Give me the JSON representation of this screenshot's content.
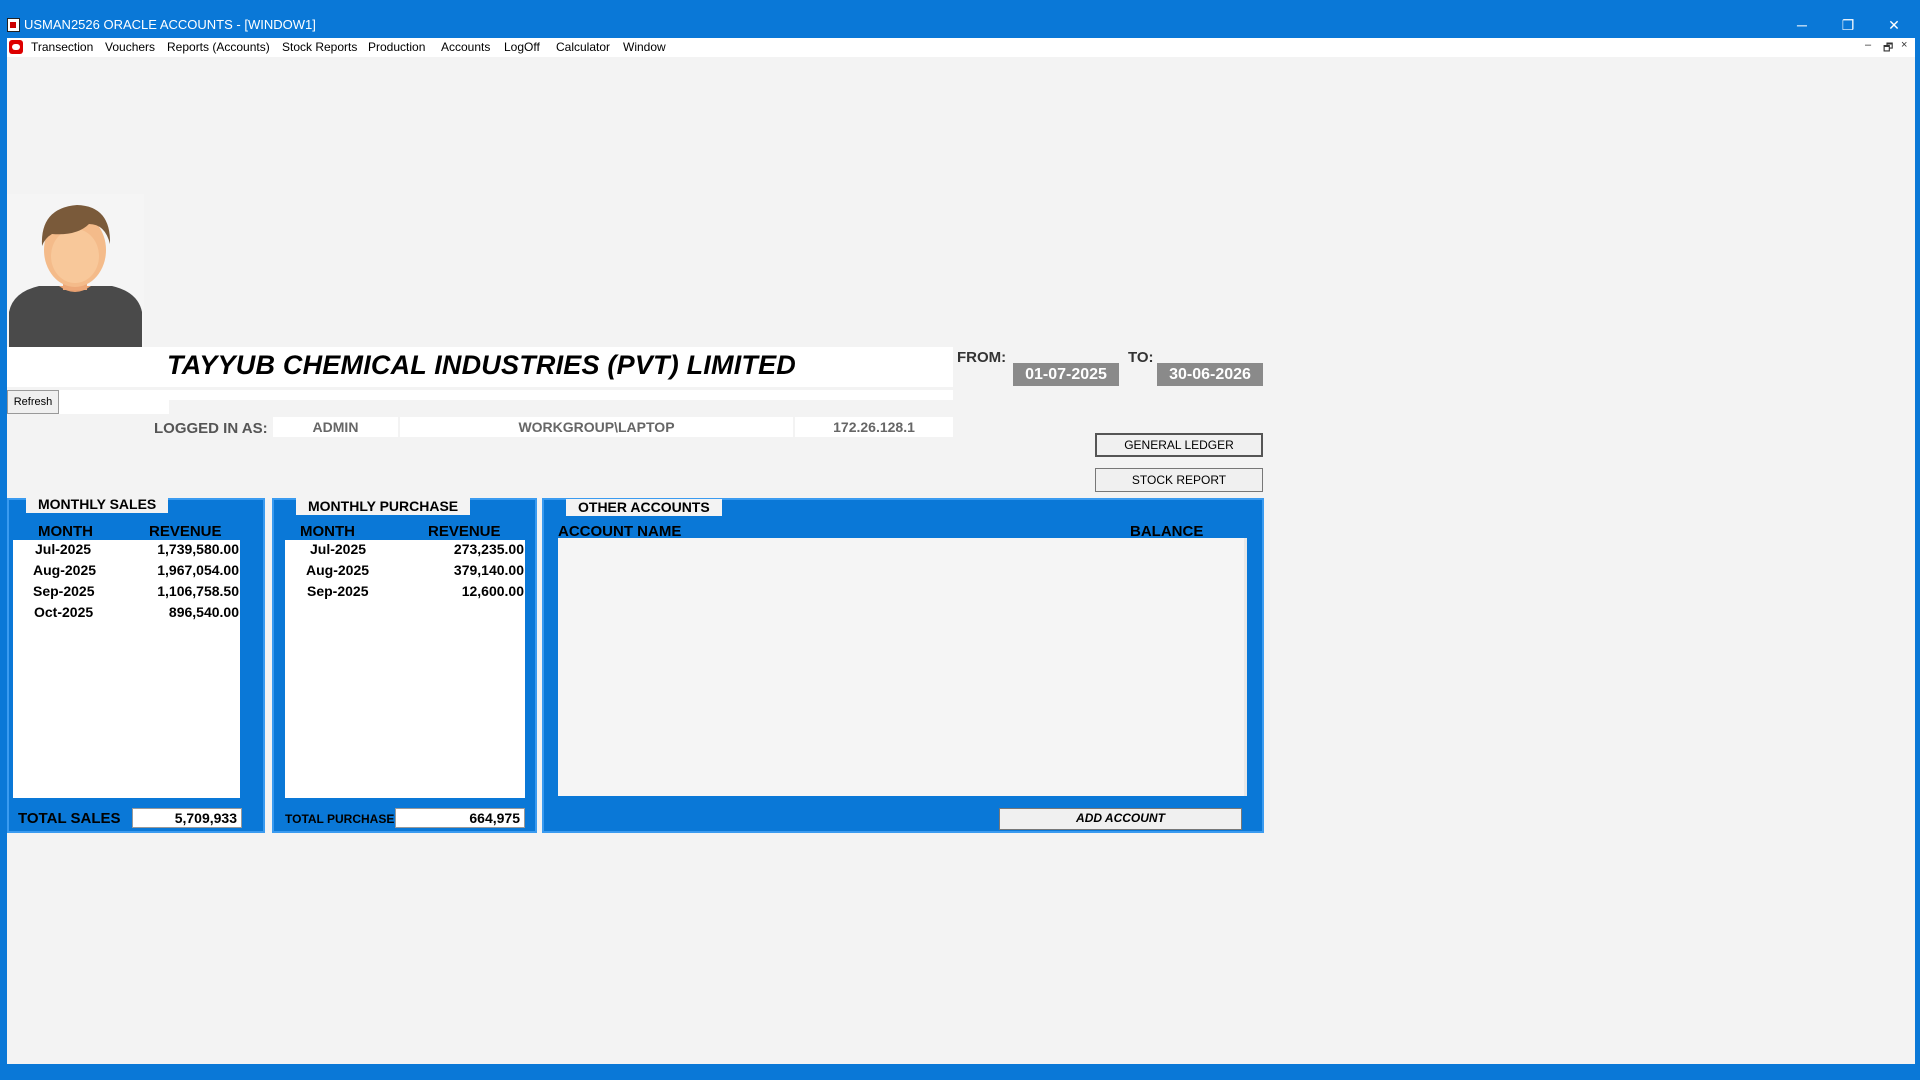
{
  "window": {
    "title": "USMAN2526 ORACLE ACCOUNTS - [WINDOW1]",
    "controls": {
      "minimize": "─",
      "restore": "❐",
      "close": "✕"
    }
  },
  "menu": {
    "items": [
      "Transection",
      "Vouchers",
      "Reports (Accounts)",
      "Stock Reports",
      "Production",
      "Accounts",
      "LogOff",
      "Calculator",
      "Window"
    ],
    "mdi_controls": {
      "minimize": "–",
      "restore": "🗗",
      "close": "×"
    }
  },
  "company": {
    "name": "TAYYUB CHEMICAL INDUSTRIES (PVT) LIMITED"
  },
  "toolbar": {
    "refresh_label": "Refresh"
  },
  "session": {
    "logged_in_label": "LOGGED IN AS:",
    "user": "ADMIN",
    "machine": "WORKGROUP\\LAPTOP",
    "ip": "172.26.128.1"
  },
  "period": {
    "from_label": "FROM:",
    "from": "01-07-2025",
    "to_label": "TO:",
    "to": "30-06-2026"
  },
  "actions": {
    "general_ledger": "GENERAL LEDGER",
    "stock_report": "STOCK REPORT"
  },
  "sales": {
    "title": "MONTHLY SALES",
    "col_month": "MONTH",
    "col_revenue": "REVENUE",
    "rows": [
      {
        "month": "Jul-2025",
        "revenue": "1,739,580.00"
      },
      {
        "month": "Aug-2025",
        "revenue": "1,967,054.00"
      },
      {
        "month": "Sep-2025",
        "revenue": "1,106,758.50"
      },
      {
        "month": "Oct-2025",
        "revenue": "896,540.00"
      }
    ],
    "total_label": "TOTAL SALES",
    "total": "5,709,933"
  },
  "purchase": {
    "title": "MONTHLY PURCHASE",
    "col_month": "MONTH",
    "col_revenue": "REVENUE",
    "rows": [
      {
        "month": "Jul-2025",
        "revenue": "273,235.00"
      },
      {
        "month": "Aug-2025",
        "revenue": "379,140.00"
      },
      {
        "month": "Sep-2025",
        "revenue": "12,600.00"
      }
    ],
    "total_label": "TOTAL PURCHASE",
    "total": "664,975"
  },
  "other_accounts": {
    "title": "OTHER ACCOUNTS",
    "col_name": "ACCOUNT NAME",
    "col_balance": "BALANCE",
    "add_label": "ADD ACCOUNT"
  }
}
